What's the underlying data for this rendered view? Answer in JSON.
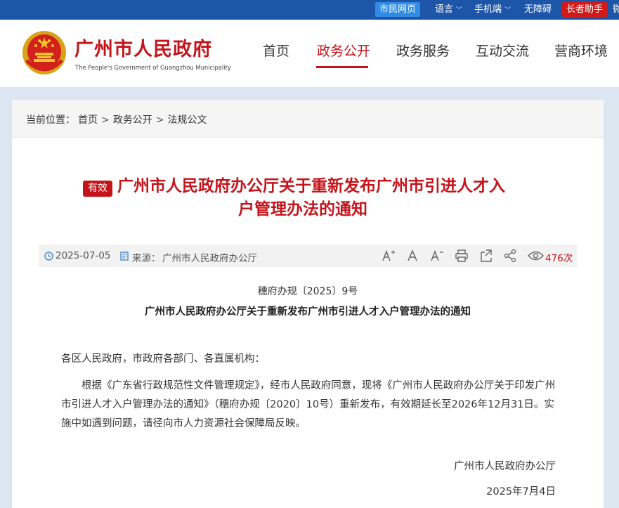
{
  "topbar": {
    "citizen": "市民网页",
    "language": "语言",
    "mobile": "手机端",
    "accessibility": "无障碍",
    "elderly": "长者助手",
    "overflow": "微"
  },
  "header": {
    "brand_cn": "广州市人民政府",
    "brand_en": "The People's Government of Guangzhou Municipality",
    "nav": [
      "首页",
      "政务公开",
      "政务服务",
      "互动交流",
      "营商环境"
    ],
    "active_nav": "政务公开"
  },
  "breadcrumb": {
    "prefix": "当前位置：",
    "items": [
      "首页",
      "政务公开",
      "法规公文"
    ],
    "separator": ">"
  },
  "article": {
    "status_badge": "有效",
    "title_line1": "广州市人民政府办公厅关于重新发布广州市引进人才入",
    "title_line2": "户管理办法的通知",
    "date": "2025-07-05",
    "source_label": "来源：",
    "source": "广州市人民政府办公厅",
    "views_count": "476",
    "views_unit": "次",
    "doc_number": "穗府办规〔2025〕9号",
    "subtitle": "广州市人民政府办公厅关于重新发布广州市引进人才入户管理办法的通知",
    "salutation": "各区人民政府，市政府各部门、各直属机构：",
    "body": "根据《广东省行政规范性文件管理规定》，经市人民政府同意，现将《广州市人民政府办公厅关于印发广州市引进人才入户管理办法的通知》（穗府办规〔2020〕10号）重新发布，有效期延长至2026年12月31日。实施中如遇到问题，请径向市人力资源社会保障局反映。",
    "signer": "广州市人民政府办公厅",
    "sign_date": "2025年7月4日"
  },
  "colors": {
    "topbar": "#1d56a8",
    "accent_red": "#c4141b",
    "pill_blue": "#2f8be4"
  }
}
